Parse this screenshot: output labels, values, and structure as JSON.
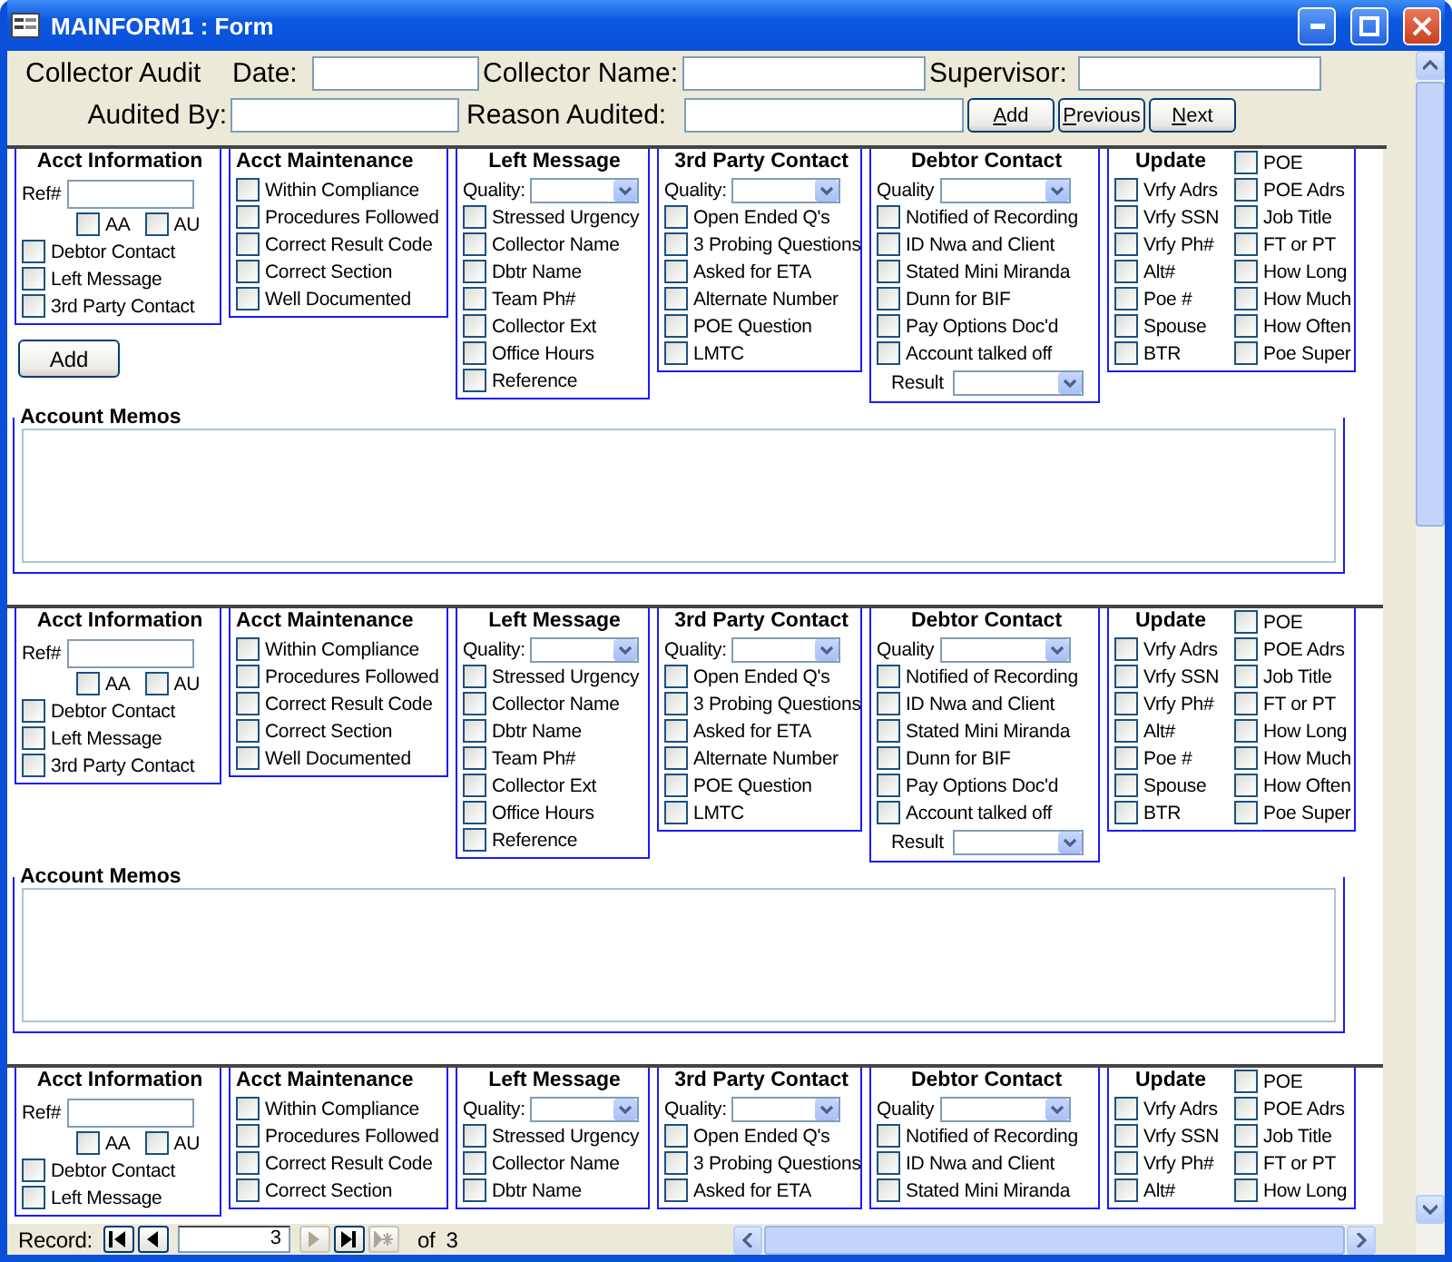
{
  "window": {
    "title": "MAINFORM1 : Form"
  },
  "header": {
    "title": "Collector Audit",
    "date_label": "Date:",
    "collector_label": "Collector Name:",
    "supervisor_label": "Supervisor:",
    "audited_by_label": "Audited By:",
    "reason_label": "Reason Audited:",
    "buttons": [
      "Add",
      "Previous",
      "Next"
    ]
  },
  "records": [
    {
      "acct_info": {
        "title": "Acct Information",
        "ref_label": "Ref#",
        "pair": [
          {
            "label": "AA",
            "checked": false
          },
          {
            "label": "AU",
            "checked": false
          }
        ],
        "items": [
          {
            "label": "Debtor Contact",
            "checked": false
          },
          {
            "label": "Left Message",
            "checked": false
          },
          {
            "label": "3rd Party Contact",
            "checked": false
          }
        ]
      },
      "add_button": "Add",
      "maintenance": {
        "title": "Acct Maintenance",
        "items": [
          {
            "label": "Within Compliance",
            "checked": false
          },
          {
            "label": "Procedures Followed",
            "checked": false
          },
          {
            "label": "Correct Result Code",
            "checked": false
          },
          {
            "label": "Correct Section",
            "checked": false
          },
          {
            "label": "Well Documented",
            "checked": false
          }
        ]
      },
      "left_message": {
        "title": "Left Message",
        "quality_label": "Quality:",
        "items": [
          {
            "label": "Stressed Urgency",
            "checked": false
          },
          {
            "label": "Collector Name",
            "checked": false
          },
          {
            "label": "Dbtr Name",
            "checked": false
          },
          {
            "label": "Team Ph#",
            "checked": false
          },
          {
            "label": "Collector Ext",
            "checked": false
          },
          {
            "label": "Office Hours",
            "checked": false
          },
          {
            "label": "Reference",
            "checked": false
          }
        ]
      },
      "third_party": {
        "title": "3rd Party Contact",
        "quality_label": "Quality:",
        "items": [
          {
            "label": "Open Ended Q's",
            "checked": false
          },
          {
            "label": "3 Probing Questions",
            "checked": false
          },
          {
            "label": "Asked for ETA",
            "checked": false
          },
          {
            "label": "Alternate Number",
            "checked": false
          },
          {
            "label": "POE Question",
            "checked": false
          },
          {
            "label": "LMTC",
            "checked": false
          }
        ]
      },
      "debtor": {
        "title": "Debtor Contact",
        "quality_label": "Quality",
        "result_label": "Result",
        "items": [
          {
            "label": "Notified of Recording",
            "checked": false
          },
          {
            "label": "ID Nwa and Client",
            "checked": false
          },
          {
            "label": "Stated Mini Miranda",
            "checked": false
          },
          {
            "label": "Dunn for BIF",
            "checked": false
          },
          {
            "label": "Pay Options Doc'd",
            "checked": false
          },
          {
            "label": "Account talked off",
            "checked": false
          }
        ]
      },
      "update": {
        "title": "Update",
        "left": [
          {
            "label": "Vrfy Adrs",
            "checked": false
          },
          {
            "label": "Vrfy SSN",
            "checked": false
          },
          {
            "label": "Vrfy Ph#",
            "checked": false
          },
          {
            "label": "Alt#",
            "checked": false
          },
          {
            "label": "Poe #",
            "checked": false
          },
          {
            "label": "Spouse",
            "checked": false
          },
          {
            "label": "BTR",
            "checked": false
          }
        ],
        "right": [
          {
            "label": "POE",
            "checked": false
          },
          {
            "label": "POE Adrs",
            "checked": false
          },
          {
            "label": "Job Title",
            "checked": false
          },
          {
            "label": "FT or PT",
            "checked": false
          },
          {
            "label": "How Long",
            "checked": false
          },
          {
            "label": "How Much",
            "checked": false
          },
          {
            "label": "How Often",
            "checked": false
          },
          {
            "label": "Poe Super",
            "checked": false
          }
        ]
      },
      "memos": {
        "title": "Account Memos"
      }
    },
    {
      "acct_info": {
        "title": "Acct Information",
        "ref_label": "Ref#",
        "pair": [
          {
            "label": "AA",
            "checked": false
          },
          {
            "label": "AU",
            "checked": false
          }
        ],
        "items": [
          {
            "label": "Debtor Contact",
            "checked": false
          },
          {
            "label": "Left Message",
            "checked": false
          },
          {
            "label": "3rd Party Contact",
            "checked": false
          }
        ]
      },
      "maintenance": {
        "title": "Acct Maintenance",
        "items": [
          {
            "label": "Within Compliance",
            "checked": false
          },
          {
            "label": "Procedures Followed",
            "checked": false
          },
          {
            "label": "Correct Result Code",
            "checked": false
          },
          {
            "label": "Correct Section",
            "checked": false
          },
          {
            "label": "Well Documented",
            "checked": false
          }
        ]
      },
      "left_message": {
        "title": "Left Message",
        "quality_label": "Quality:",
        "items": [
          {
            "label": "Stressed Urgency",
            "checked": false
          },
          {
            "label": "Collector Name",
            "checked": false
          },
          {
            "label": "Dbtr Name",
            "checked": false
          },
          {
            "label": "Team Ph#",
            "checked": false
          },
          {
            "label": "Collector Ext",
            "checked": false
          },
          {
            "label": "Office Hours",
            "checked": false
          },
          {
            "label": "Reference",
            "checked": false
          }
        ]
      },
      "third_party": {
        "title": "3rd Party Contact",
        "quality_label": "Quality:",
        "items": [
          {
            "label": "Open Ended Q's",
            "checked": false
          },
          {
            "label": "3 Probing Questions",
            "checked": false
          },
          {
            "label": "Asked for ETA",
            "checked": false
          },
          {
            "label": "Alternate Number",
            "checked": false
          },
          {
            "label": "POE Question",
            "checked": false
          },
          {
            "label": "LMTC",
            "checked": false
          }
        ]
      },
      "debtor": {
        "title": "Debtor Contact",
        "quality_label": "Quality",
        "result_label": "Result",
        "items": [
          {
            "label": "Notified of Recording",
            "checked": false
          },
          {
            "label": "ID Nwa and Client",
            "checked": false
          },
          {
            "label": "Stated Mini Miranda",
            "checked": false
          },
          {
            "label": "Dunn for BIF",
            "checked": false
          },
          {
            "label": "Pay Options Doc'd",
            "checked": false
          },
          {
            "label": "Account talked off",
            "checked": false
          }
        ]
      },
      "update": {
        "title": "Update",
        "left": [
          {
            "label": "Vrfy Adrs",
            "checked": false
          },
          {
            "label": "Vrfy SSN",
            "checked": false
          },
          {
            "label": "Vrfy Ph#",
            "checked": false
          },
          {
            "label": "Alt#",
            "checked": false
          },
          {
            "label": "Poe #",
            "checked": false
          },
          {
            "label": "Spouse",
            "checked": false
          },
          {
            "label": "BTR",
            "checked": false
          }
        ],
        "right": [
          {
            "label": "POE",
            "checked": false
          },
          {
            "label": "POE Adrs",
            "checked": false
          },
          {
            "label": "Job Title",
            "checked": false
          },
          {
            "label": "FT or PT",
            "checked": false
          },
          {
            "label": "How Long",
            "checked": false
          },
          {
            "label": "How Much",
            "checked": false
          },
          {
            "label": "How Often",
            "checked": false
          },
          {
            "label": "Poe Super",
            "checked": false
          }
        ]
      },
      "memos": {
        "title": "Account Memos"
      }
    },
    {
      "acct_info": {
        "title": "Acct Information",
        "ref_label": "Ref#",
        "pair": [
          {
            "label": "AA",
            "checked": false
          },
          {
            "label": "AU",
            "checked": false
          }
        ],
        "items": [
          {
            "label": "Debtor Contact",
            "checked": false
          },
          {
            "label": "Left Message",
            "checked": false
          }
        ]
      },
      "maintenance": {
        "title": "Acct Maintenance",
        "items": [
          {
            "label": "Within Compliance",
            "checked": false
          },
          {
            "label": "Procedures Followed",
            "checked": false
          },
          {
            "label": "Correct Result Code",
            "checked": false
          },
          {
            "label": "Correct Section",
            "checked": false
          }
        ]
      },
      "left_message": {
        "title": "Left Message",
        "quality_label": "Quality:",
        "items": [
          {
            "label": "Stressed Urgency",
            "checked": false
          },
          {
            "label": "Collector Name",
            "checked": false
          },
          {
            "label": "Dbtr Name",
            "checked": false
          }
        ]
      },
      "third_party": {
        "title": "3rd Party Contact",
        "quality_label": "Quality:",
        "items": [
          {
            "label": "Open Ended Q's",
            "checked": false
          },
          {
            "label": "3 Probing Questions",
            "checked": false
          },
          {
            "label": "Asked for ETA",
            "checked": false
          }
        ]
      },
      "debtor": {
        "title": "Debtor Contact",
        "quality_label": "Quality",
        "items": [
          {
            "label": "Notified of Recording",
            "checked": false
          },
          {
            "label": "ID Nwa and Client",
            "checked": false
          },
          {
            "label": "Stated Mini Miranda",
            "checked": false
          }
        ]
      },
      "update": {
        "title": "Update",
        "left": [
          {
            "label": "Vrfy Adrs",
            "checked": false
          },
          {
            "label": "Vrfy SSN",
            "checked": false
          },
          {
            "label": "Vrfy Ph#",
            "checked": false
          },
          {
            "label": "Alt#",
            "checked": false
          }
        ],
        "right": [
          {
            "label": "POE",
            "checked": false
          },
          {
            "label": "POE Adrs",
            "checked": false
          },
          {
            "label": "Job Title",
            "checked": false
          },
          {
            "label": "FT or PT",
            "checked": false
          },
          {
            "label": "How Long",
            "checked": false
          }
        ]
      }
    }
  ],
  "record_nav": {
    "label": "Record:",
    "current": "3",
    "of_label": "of",
    "total": "3"
  }
}
